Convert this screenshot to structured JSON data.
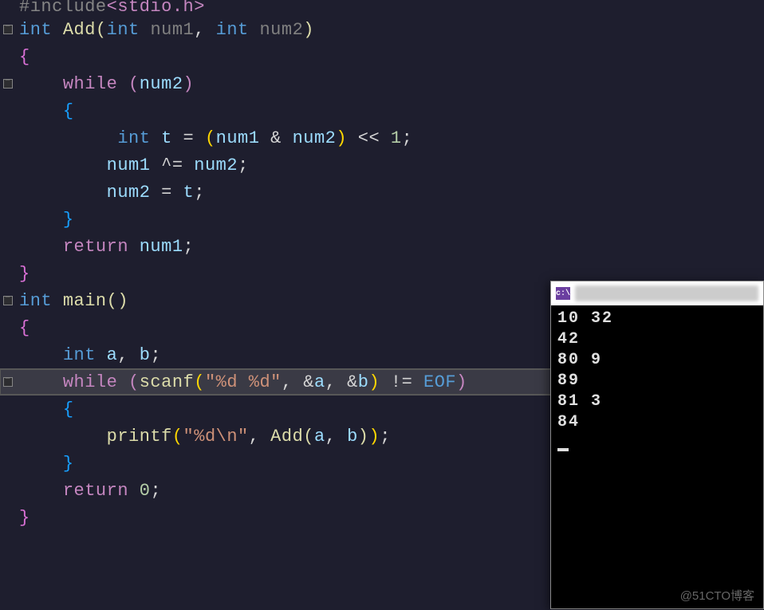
{
  "code": {
    "include_hash": "#include",
    "include_file": "<stdio.h>",
    "int": "int",
    "add_fn": "Add",
    "main_fn": "main",
    "printf_fn": "printf",
    "scanf_fn": "scanf",
    "num1": "num1",
    "num2": "num2",
    "a": "a",
    "b": "b",
    "t": "t",
    "while": "while",
    "return": "return",
    "zero": "0",
    "one": "1",
    "shift": " << ",
    "eq": " = ",
    "xoreq": " ^= ",
    "neq": " != ",
    "amp": " & ",
    "addr": "&",
    "eof": "EOF",
    "fmt_dd": "\"%d %d\"",
    "fmt_dn": "\"%d\\n\"",
    "comma": ", ",
    "semi": ";",
    "lp": "(",
    "rp": ")",
    "lb": "{",
    "rb": "}"
  },
  "console": {
    "icon_text": "c:\\",
    "lines": [
      "10 32",
      "42",
      "80 9",
      "89",
      "81 3",
      "84"
    ]
  },
  "watermark": "@51CTO博客"
}
